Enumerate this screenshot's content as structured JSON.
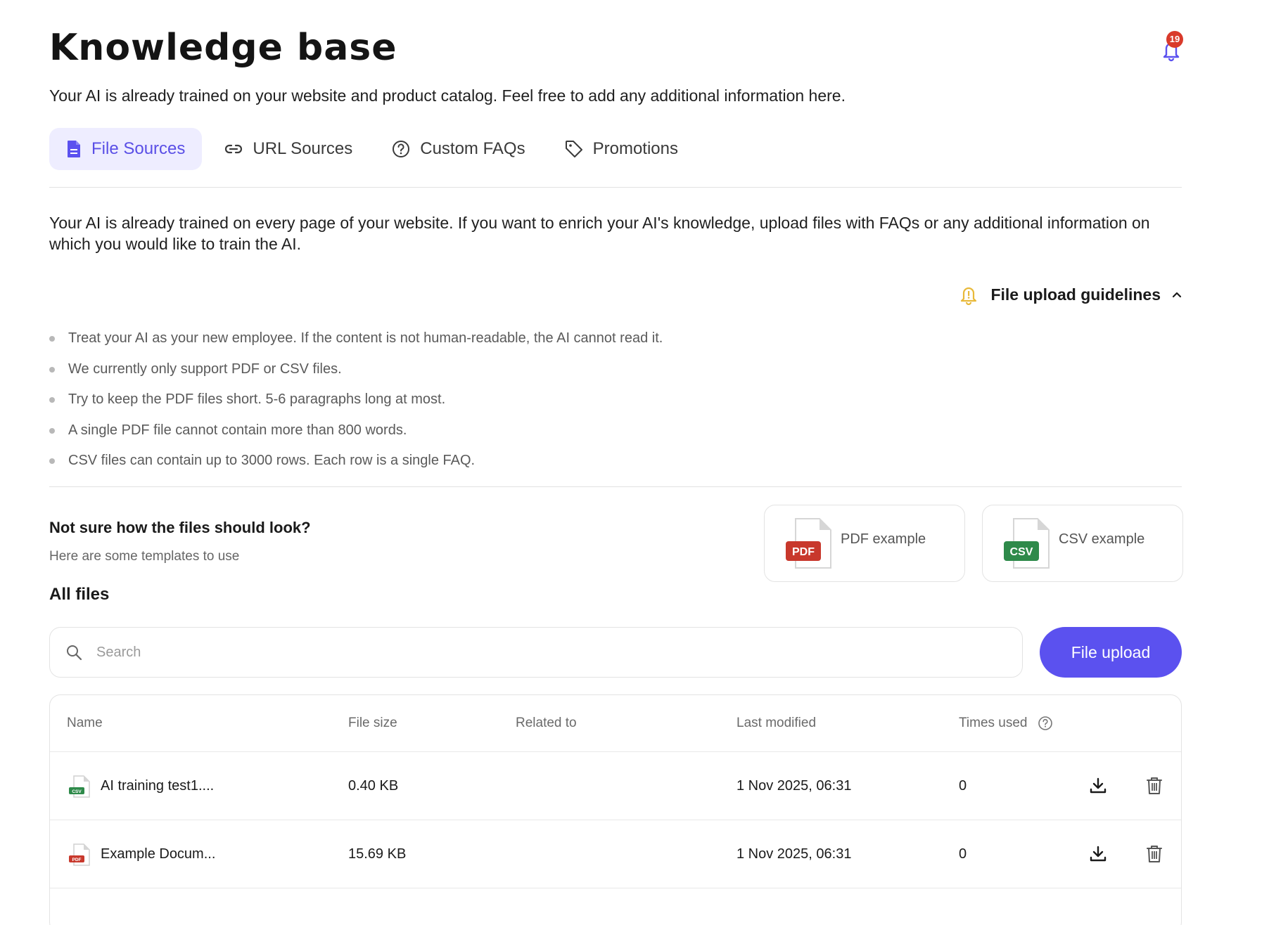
{
  "header": {
    "title": "Knowledge base",
    "subtitle": "Your AI is already trained on your website and product catalog. Feel free to add any additional information here.",
    "notification_count": "19"
  },
  "tabs": [
    {
      "label": "File Sources",
      "icon": "document-icon",
      "active": true
    },
    {
      "label": "URL Sources",
      "icon": "link-icon",
      "active": false
    },
    {
      "label": "Custom FAQs",
      "icon": "question-circle-icon",
      "active": false
    },
    {
      "label": "Promotions",
      "icon": "tag-icon",
      "active": false
    }
  ],
  "intro": "Your AI is already trained on every page of your website. If you want to enrich your AI's knowledge, upload files with FAQs or any additional information on which you would like to train the AI.",
  "guidelines": {
    "title": "File upload guidelines",
    "expanded": true,
    "items": [
      "Treat your AI as your new employee. If the content is not human-readable, the AI cannot read it.",
      "We currently only support PDF or CSV files.",
      "Try to keep the PDF files short. 5-6 paragraphs long at most.",
      "A single PDF file cannot contain more than 800 words.",
      "CSV files can contain up to 3000 rows. Each row is a single FAQ."
    ]
  },
  "templates": {
    "heading": "Not sure how the files should look?",
    "subheading": "Here are some templates to use",
    "pdf": {
      "badge": "PDF",
      "label": "PDF example"
    },
    "csv": {
      "badge": "CSV",
      "label": "CSV example"
    }
  },
  "files": {
    "heading": "All files",
    "search_placeholder": "Search",
    "upload_label": "File upload",
    "columns": [
      "Name",
      "File size",
      "Related to",
      "Last modified",
      "Times used"
    ],
    "rows": [
      {
        "type": "CSV",
        "name": "AI training test1....",
        "size": "0.40 KB",
        "related": "",
        "modified": "1 Nov 2025, 06:31",
        "used": "0"
      },
      {
        "type": "PDF",
        "name": "Example Docum...",
        "size": "15.69 KB",
        "related": "",
        "modified": "1 Nov 2025, 06:31",
        "used": "0"
      }
    ]
  },
  "colors": {
    "accent": "#5b51ef",
    "accent_soft": "#eeedff",
    "pdf_red": "#c8382c",
    "csv_green": "#2e8a4a",
    "badge_red": "#d93a2b",
    "warning_yellow": "#e8b93a"
  }
}
